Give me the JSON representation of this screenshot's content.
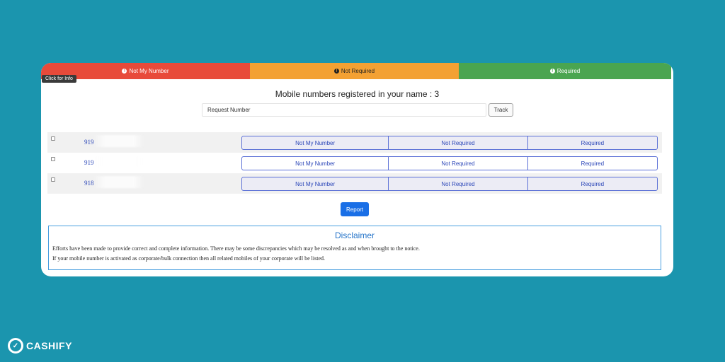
{
  "legend": {
    "not_my_number": "Not My Number",
    "not_required": "Not Required",
    "required": "Required",
    "tooltip": "Click for Info",
    "colors": {
      "red": "#e84a3a",
      "orange": "#f3a133",
      "green": "#4aa550"
    }
  },
  "title": "Mobile numbers registered in your name : 3",
  "search": {
    "placeholder": "Request Number",
    "track_label": "Track"
  },
  "rows": [
    {
      "number": "919",
      "options": [
        "Not My Number",
        "Not Required",
        "Required"
      ]
    },
    {
      "number": "919",
      "options": [
        "Not My Number",
        "Not Required",
        "Required"
      ]
    },
    {
      "number": "918",
      "options": [
        "Not My Number",
        "Not Required",
        "Required"
      ]
    }
  ],
  "report_label": "Report",
  "disclaimer": {
    "title": "Disclaimer",
    "line1": "Efforts have been made to provide correct and complete information. There may be some discrepancies which may be resolved as and when brought to the notice.",
    "line2": "If your mobile number is activated as corporate/bulk connection then all related mobiles of your corporate will be listed."
  },
  "brand": {
    "name": "CASHIFY"
  }
}
